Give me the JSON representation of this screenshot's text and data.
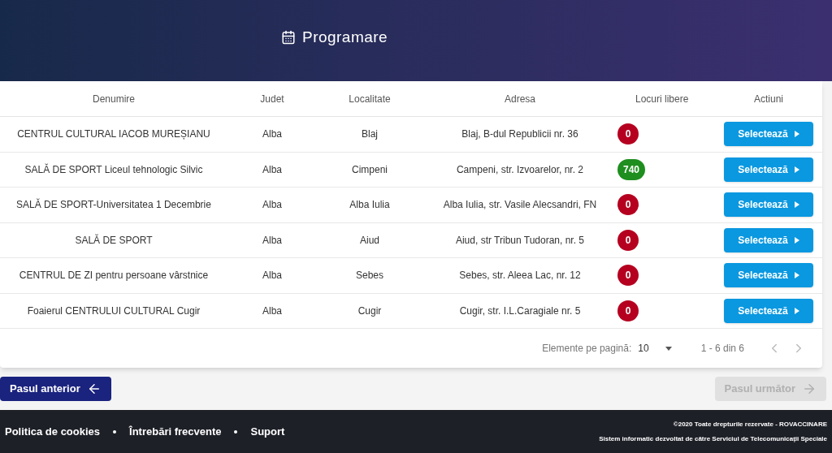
{
  "header": {
    "title": "Programare"
  },
  "table": {
    "columns": [
      "Denumire",
      "Judet",
      "Localitate",
      "Adresa",
      "Locuri libere",
      "Actiuni"
    ],
    "rows": [
      {
        "name": "CENTRUL CULTURAL IACOB MUREȘIANU",
        "county": "Alba",
        "city": "Blaj",
        "address": "Blaj, B-dul Republicii nr. 36",
        "free": "0",
        "color": "#b5001f",
        "action": "Selectează"
      },
      {
        "name": "SALĂ DE SPORT Liceul tehnologic Silvic",
        "county": "Alba",
        "city": "Cimpeni",
        "address": "Campeni, str. Izvoarelor, nr. 2",
        "free": "740",
        "color": "#1e8e1e",
        "action": "Selectează"
      },
      {
        "name": "SALĂ DE SPORT-Universitatea 1 Decembrie",
        "county": "Alba",
        "city": "Alba Iulia",
        "address": "Alba Iulia, str. Vasile Alecsandri, FN",
        "free": "0",
        "color": "#b5001f",
        "action": "Selectează"
      },
      {
        "name": "SALĂ DE SPORT",
        "county": "Alba",
        "city": "Aiud",
        "address": "Aiud, str Tribun Tudoran, nr. 5",
        "free": "0",
        "color": "#b5001f",
        "action": "Selectează"
      },
      {
        "name": "CENTRUL DE ZI pentru persoane vârstnice",
        "county": "Alba",
        "city": "Sebes",
        "address": "Sebes, str. Aleea Lac, nr. 12",
        "free": "0",
        "color": "#b5001f",
        "action": "Selectează"
      },
      {
        "name": "Foaierul CENTRULUI CULTURAL Cugir",
        "county": "Alba",
        "city": "Cugir",
        "address": "Cugir, str. I.L.Caragiale nr. 5",
        "free": "0",
        "color": "#b5001f",
        "action": "Selectează"
      }
    ]
  },
  "pagination": {
    "label": "Elemente pe pagină:",
    "page_size": "10",
    "range": "1 - 6 din 6"
  },
  "nav": {
    "previous": {
      "label": "Pasul anterior",
      "disabled": false
    },
    "next": {
      "label": "Pasul următor",
      "disabled": true
    }
  },
  "footer": {
    "links": [
      "Politica de cookies",
      "Întrebări frecvente",
      "Suport"
    ],
    "copyright": "©2020 Toate drepturile rezervate - ROVACCINARE",
    "credit": "Sistem informatic dezvoltat de către Serviciul de Telecomunicații Speciale"
  }
}
